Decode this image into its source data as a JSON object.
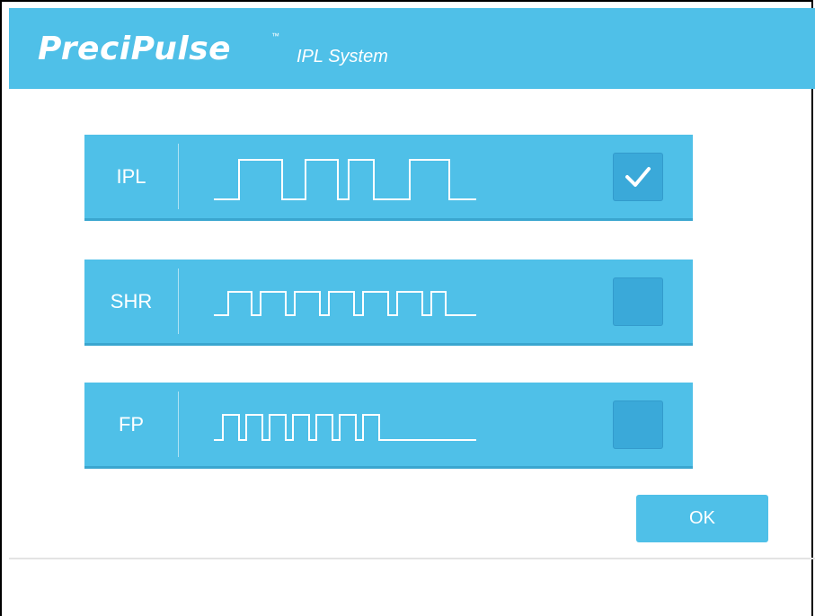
{
  "header": {
    "logo_text": "PreciPulse",
    "trademark": "™",
    "subtitle": "IPL System",
    "color": "#4fc0e8"
  },
  "modes": [
    {
      "label": "IPL",
      "checked": true,
      "wave_icon": "wide-pulse-waveform"
    },
    {
      "label": "SHR",
      "checked": false,
      "wave_icon": "regular-pulse-waveform"
    },
    {
      "label": "FP",
      "checked": false,
      "wave_icon": "fast-pulse-waveform"
    }
  ],
  "ok_button": {
    "label": "OK"
  },
  "colors": {
    "accent": "#4fc0e8",
    "checkbox": "#3aa9d9",
    "text": "#ffffff"
  }
}
